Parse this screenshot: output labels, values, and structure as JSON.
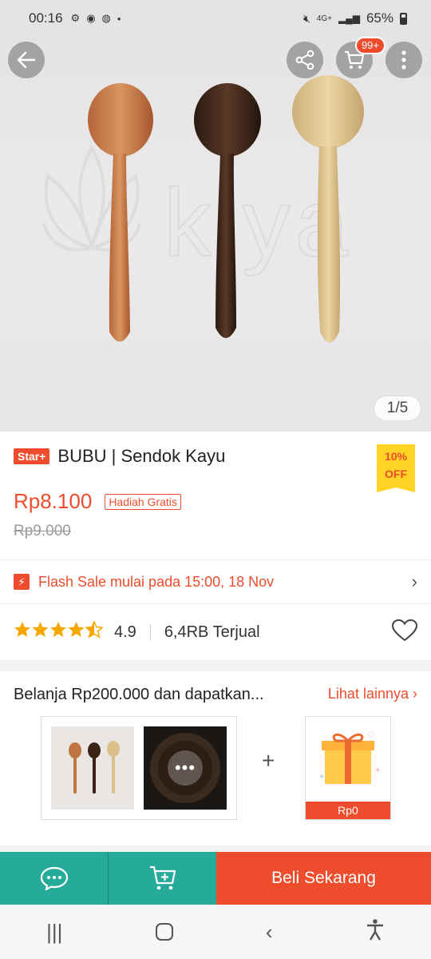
{
  "status_bar": {
    "time": "00:16",
    "battery": "65%",
    "network": "4G+"
  },
  "gallery": {
    "counter": "1/5",
    "cart_badge": "99+",
    "watermark": "kiya"
  },
  "product": {
    "badge": "Star+",
    "title": "BUBU | Sendok Kayu",
    "discount": {
      "line1": "10%",
      "line2": "OFF"
    },
    "price": "Rp8.100",
    "gift_tag": "Hadiah Gratis",
    "original_price": "Rp9.000"
  },
  "flash_sale": {
    "text": "Flash Sale mulai pada 15:00, 18 Nov"
  },
  "rating": {
    "stars_value": 4.9,
    "value": "4.9",
    "sold": "6,4RB Terjual"
  },
  "promo": {
    "title": "Belanja Rp200.000 dan dapatkan...",
    "see_more": "Lihat lainnya",
    "more_dots": "•••",
    "plus": "+",
    "gift_price": "Rp0"
  },
  "actions": {
    "buy_label": "Beli Sekarang"
  },
  "colors": {
    "brand": "#ee4d2d",
    "teal": "#26aa99",
    "star": "#f6a700"
  }
}
